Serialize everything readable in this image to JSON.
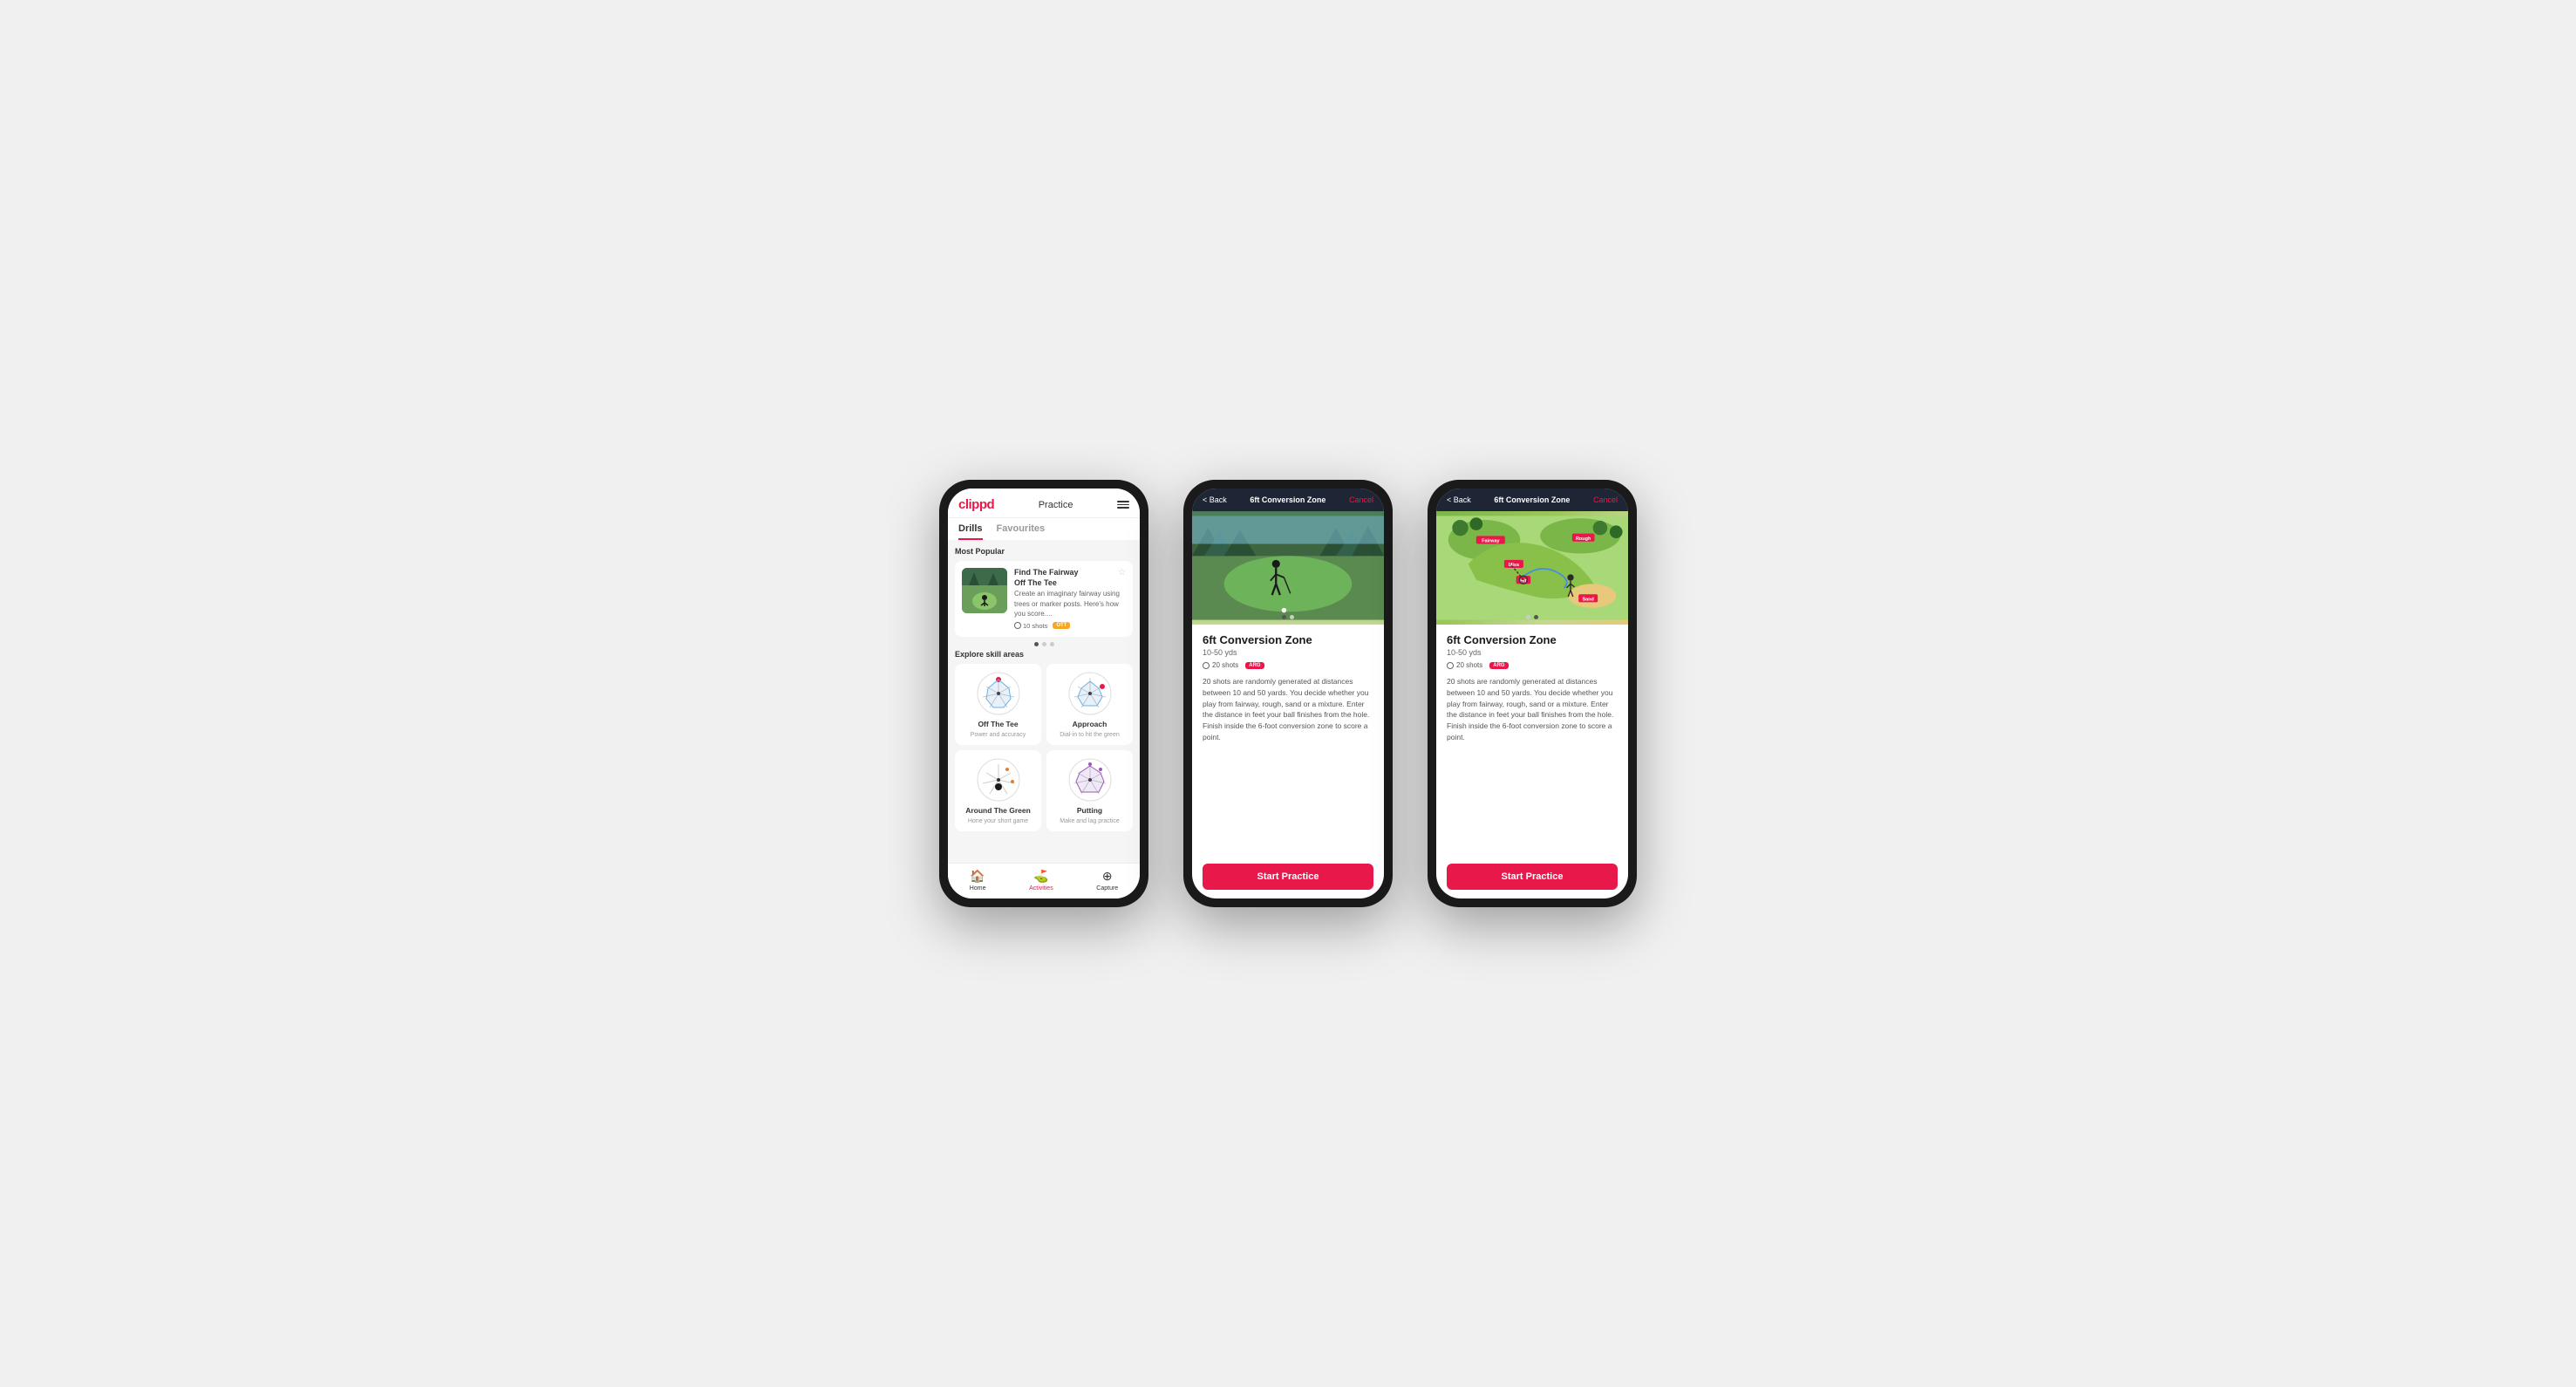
{
  "app": {
    "logo": "clippd",
    "header_title": "Practice",
    "hamburger_label": "menu"
  },
  "phone1": {
    "tabs": [
      {
        "label": "Drills",
        "active": true
      },
      {
        "label": "Favourites",
        "active": false
      }
    ],
    "most_popular_title": "Most Popular",
    "featured_drill": {
      "name": "Find The Fairway",
      "subtitle": "Off The Tee",
      "description": "Create an imaginary fairway using trees or marker posts. Here's how you score....",
      "shots": "10 shots",
      "tag": "OTT"
    },
    "dots": [
      {
        "active": true
      },
      {
        "active": false
      },
      {
        "active": false
      }
    ],
    "explore_title": "Explore skill areas",
    "skills": [
      {
        "name": "Off The Tee",
        "desc": "Power and accuracy"
      },
      {
        "name": "Approach",
        "desc": "Dial-in to hit the green"
      },
      {
        "name": "Around The Green",
        "desc": "Hone your short game"
      },
      {
        "name": "Putting",
        "desc": "Make and lag practice"
      }
    ],
    "nav": [
      {
        "label": "Home",
        "icon": "🏠",
        "active": false
      },
      {
        "label": "Activities",
        "icon": "⛳",
        "active": true
      },
      {
        "label": "Capture",
        "icon": "➕",
        "active": false
      }
    ]
  },
  "phone2": {
    "back_label": "< Back",
    "header_title": "6ft Conversion Zone",
    "cancel_label": "Cancel",
    "drill_name": "6ft Conversion Zone",
    "drill_range": "10-50 yds",
    "shots": "20 shots",
    "tag": "ARG",
    "image_type": "photo",
    "description": "20 shots are randomly generated at distances between 10 and 50 yards. You decide whether you play from fairway, rough, sand or a mixture. Enter the distance in feet your ball finishes from the hole. Finish inside the 6-foot conversion zone to score a point.",
    "start_button": "Start Practice",
    "dots": [
      {
        "active": true
      },
      {
        "active": false
      }
    ]
  },
  "phone3": {
    "back_label": "< Back",
    "header_title": "6ft Conversion Zone",
    "cancel_label": "Cancel",
    "drill_name": "6ft Conversion Zone",
    "drill_range": "10-50 yds",
    "shots": "20 shots",
    "tag": "ARG",
    "image_type": "map",
    "description": "20 shots are randomly generated at distances between 10 and 50 yards. You decide whether you play from fairway, rough, sand or a mixture. Enter the distance in feet your ball finishes from the hole. Finish inside the 6-foot conversion zone to score a point.",
    "start_button": "Start Practice",
    "dots": [
      {
        "active": false
      },
      {
        "active": true
      }
    ],
    "map_labels": [
      "Fairway",
      "Rough",
      "Miss",
      "Hit",
      "Sand"
    ]
  }
}
